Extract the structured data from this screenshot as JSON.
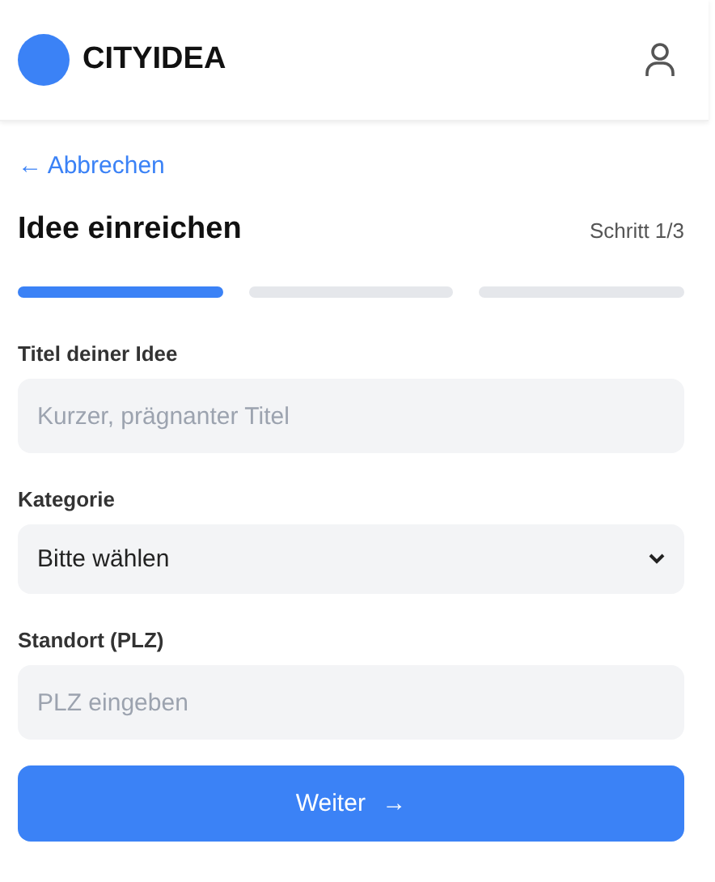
{
  "header": {
    "logo_text": "CITYIDEA"
  },
  "back_link": {
    "icon": "←",
    "label": "Abbrechen"
  },
  "title": "Idee einreichen",
  "step_label": "Schritt 1/3",
  "steps": [
    {
      "done": true
    },
    {
      "done": false
    },
    {
      "done": false
    }
  ],
  "fields": [
    {
      "kind": "input",
      "label": "Titel deiner Idee",
      "placeholder": "Kurzer, prägnanter Titel"
    },
    {
      "kind": "select",
      "label": "Kategorie",
      "value": "Bitte wählen"
    },
    {
      "kind": "input",
      "label": "Standort (PLZ)",
      "placeholder": "PLZ eingeben"
    }
  ],
  "submit": {
    "label": "Weiter",
    "icon": "→"
  }
}
